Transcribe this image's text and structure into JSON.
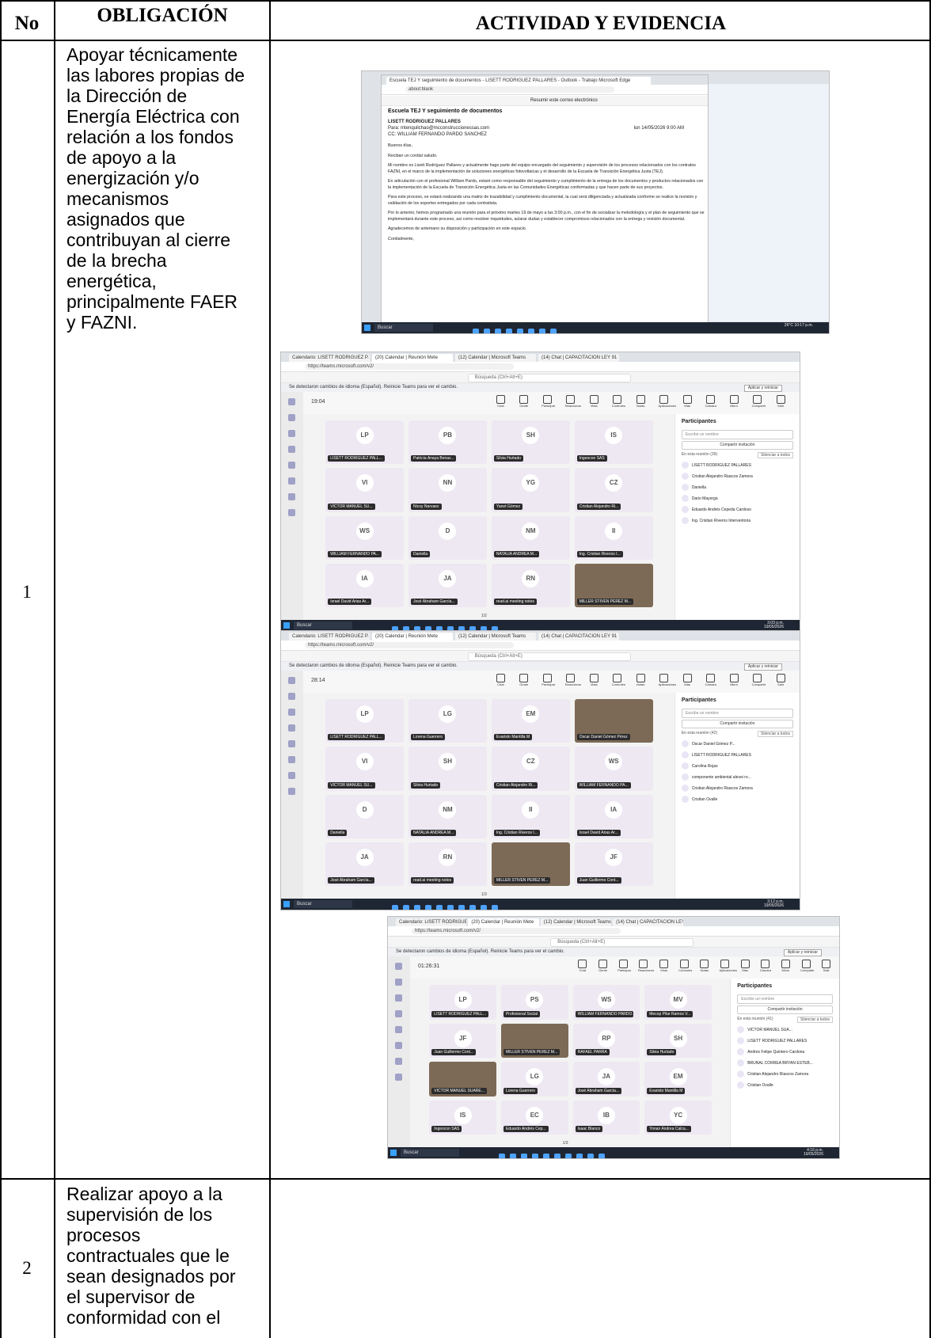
{
  "table": {
    "headers": {
      "no": "No",
      "obligacion": "OBLIGACIÓN",
      "actividad": "ACTIVIDAD Y EVIDENCIA"
    },
    "rows": [
      {
        "no": "1",
        "obligacion_lines": [
          "Apoyar técnicamente",
          "las labores propias de",
          "la Dirección de",
          "Energía Eléctrica con",
          "relación a los fondos",
          "de apoyo a la",
          "energización y/o",
          "mecanismos",
          "asignados que",
          "contribuyan al cierre",
          "de la brecha",
          "energética,",
          "principalmente FAER",
          "y FAZNI."
        ]
      },
      {
        "no": "2",
        "obligacion_lines": [
          "Realizar apoyo a la",
          "supervisión de los",
          "procesos",
          "contractuales que le",
          "sean designados por",
          "el supervisor de",
          "conformidad con el"
        ]
      }
    ]
  },
  "evidence": {
    "email": {
      "window_title": "Escuela TEJ Y seguimiento de documentos - LISETT RODRIGUEZ PALLARES - Outlook - Trabajo Microsoft Edge",
      "url": "about:blank",
      "subject": "Escuela TEJ Y seguimiento de documentos",
      "summarize": "Resumir este correo electrónico",
      "from": "LISETT RODRIGUEZ PALLARES",
      "to": "Para: mtenquilchao@mcconstruccionessas.com",
      "cc": "CC: WILLIAM FERNANDO PARDO SANCHEZ",
      "date": "lun 14/05/2026 9:00 AM",
      "body": [
        "Buenos días,",
        "Reciban un cordial saludo.",
        "Mi nombre es Lisett Rodríguez Pallares y actualmente hago parte del equipo encargado del seguimiento y supervisión de los procesos relacionados con los contratos FAZNI, en el marco de la implementación de soluciones energéticas fotovoltaicas y el desarrollo de la Escuela de Transición Energética Justa (TEJ).",
        "En articulación con el profesional William Pardo, estaré como responsable del seguimiento y cumplimiento de la entrega de los documentos y productos relacionados con la implementación de la Escuela de Transición Energética Justa en las Comunidades Energéticas conformadas y que hacen parte de sus proyectos.",
        "Para este proceso, se estará realizando una matriz de trazabilidad y cumplimiento documental, la cual será diligenciada y actualizada conforme se realice la revisión y validación de los soportes entregados por cada contratista.",
        "Por lo anterior, hemos programado una reunión para el próximo martes 19 de mayo a las 3:00 p.m., con el fin de socializar la metodología y el plan de seguimiento que se implementará durante este proceso, así como resolver inquietudes, aclarar dudas y establecer compromisos relacionados con la entrega y revisión documental.",
        "Agradecemos de antemano su disposición y participación en este espacio.",
        "Cordialmente,"
      ],
      "taskbar_search": "Buscar",
      "temp": "26°C",
      "clock": "10:17 p.m."
    },
    "meetings": [
      {
        "tabs": [
          "Calendario: LISETT RODRIGUEZ P.",
          "(20) Calendar | Reunión Mete",
          "(12) Calendar | Microsoft Teams",
          "(14) Chat | CAPACITACION LEY 91"
        ],
        "url": "https://teams.microsoft.com/v2/",
        "search": "Búsqueda (Ctrl+Alt+E)",
        "notice": "Se detectaron cambios de idioma (Español). Reinicie Teams para ver el cambio.",
        "notice_btn": "Aplicar y reiniciar",
        "timer": "19:04",
        "controls": [
          "Chat",
          "Gente",
          "Participar",
          "Reaccionar",
          "Vista",
          "Controles",
          "Notas",
          "Aplicaciones",
          "Más",
          "Cámara",
          "Micro",
          "Compartir",
          "Salir"
        ],
        "tiles": [
          {
            "i": "LP",
            "n": "LISETT RODRIGUEZ PALL..."
          },
          {
            "i": "PB",
            "n": "Patricia Anaya Benav..."
          },
          {
            "i": "SH",
            "n": "Silvia Hurtado"
          },
          {
            "i": "IS",
            "n": "Ingeocon SAS"
          },
          {
            "i": "VI",
            "n": "VICTOR MANUEL SU..."
          },
          {
            "i": "NN",
            "n": "Nicoy Narvaez"
          },
          {
            "i": "YG",
            "n": "Yanet Gómez"
          },
          {
            "i": "CZ",
            "n": "Cristian Alejandro Ri..."
          },
          {
            "i": "WS",
            "n": "WILLIAM FERNANDO PA..."
          },
          {
            "i": "D",
            "n": "Daniella"
          },
          {
            "i": "NM",
            "n": "NATALIA ANDREA M..."
          },
          {
            "i": "II",
            "n": "Ing. Cristian Riveros I..."
          },
          {
            "i": "IA",
            "n": "Israel David Arias Ar..."
          },
          {
            "i": "JA",
            "n": "José Abraham García..."
          },
          {
            "i": "RN",
            "n": "read.ai meeting notes"
          },
          {
            "i": "",
            "n": "MILLER STIVEN PEREZ M..."
          }
        ],
        "pager": "1/2",
        "panel_title": "Participantes",
        "panel_input": "Escribe un nombre",
        "panel_share": "Compartir invitación",
        "panel_section": "En esta reunión (39)",
        "panel_mute": "Silenciar a todos",
        "participants": [
          {
            "i": "LP",
            "n": "LISETT RODRIGUEZ PALLARES"
          },
          {
            "i": "CZ",
            "n": "Cristian Alejandro Riascos Zamora"
          },
          {
            "i": "D",
            "n": "Daniella"
          },
          {
            "i": "DM",
            "n": "Dario Mayorga"
          },
          {
            "i": "EC",
            "n": "Eduardo Andrés Cepeda Cardoso"
          },
          {
            "i": "II",
            "n": "Ing. Cristian Riveros Interventoria"
          }
        ],
        "organizer": "Organizador",
        "clock": "3:03 p.m.",
        "date": "19/05/2026"
      },
      {
        "tabs": [
          "Calendario: LISETT RODRIGUEZ P.",
          "(20) Calendar | Reunión Mete",
          "(12) Calendar | Microsoft Teams",
          "(14) Chat | CAPACITACION LEY 91"
        ],
        "url": "https://teams.microsoft.com/v2/",
        "search": "Búsqueda (Ctrl+Alt+E)",
        "notice": "Se detectaron cambios de idioma (Español). Reinicie Teams para ver el cambio.",
        "notice_btn": "Aplicar y reiniciar",
        "timer": "28:14",
        "controls": [
          "Chat",
          "Gente",
          "Participar",
          "Reaccionar",
          "Vista",
          "Controles",
          "Notas",
          "Aplicaciones",
          "Más",
          "Cámara",
          "Micro",
          "Compartir",
          "Salir"
        ],
        "tiles": [
          {
            "i": "LP",
            "n": "LISETT RODRIGUEZ PALL..."
          },
          {
            "i": "LG",
            "n": "Lorena Guerrero"
          },
          {
            "i": "EM",
            "n": "Evaristo Mantilla M"
          },
          {
            "i": "",
            "n": "Oscar Daniel Gómez Pérez"
          },
          {
            "i": "VI",
            "n": "VICTOR MANUEL SU..."
          },
          {
            "i": "SH",
            "n": "Silvia Hurtado"
          },
          {
            "i": "CZ",
            "n": "Cristian Alejandro Ri..."
          },
          {
            "i": "WS",
            "n": "WILLIAM FERNANDO PA..."
          },
          {
            "i": "D",
            "n": "Daniella"
          },
          {
            "i": "NM",
            "n": "NATALIA ANDREA M..."
          },
          {
            "i": "II",
            "n": "Ing. Cristian Riveros I..."
          },
          {
            "i": "IA",
            "n": "Israel David Arias Ar..."
          },
          {
            "i": "JA",
            "n": "José Abraham García..."
          },
          {
            "i": "RN",
            "n": "read.ai meeting notes"
          },
          {
            "i": "",
            "n": "MILLER STIVEN PEREZ M..."
          },
          {
            "i": "JF",
            "n": "Juan Guillermo Cont..."
          }
        ],
        "pager": "1/3",
        "panel_title": "Participantes",
        "panel_input": "Escribe un nombre",
        "panel_share": "Compartir invitación",
        "panel_section": "En esta reunión (42)",
        "panel_mute": "Silenciar a todos",
        "participants": [
          {
            "i": "OP",
            "n": "Oscar Daniel Gómez P..."
          },
          {
            "i": "LP",
            "n": "LISETT RODRIGUEZ PALLARES"
          },
          {
            "i": "CR",
            "n": "Carolina Rojas"
          },
          {
            "i": "CR",
            "n": "componente ambiental alexei ro..."
          },
          {
            "i": "CZ",
            "n": "Cristian Alejandro Riascos Zamora"
          },
          {
            "i": "CO",
            "n": "Cristian Ovalle"
          }
        ],
        "organizer": "Organizador",
        "clock": "3:12 p.m.",
        "date": "19/05/2026"
      },
      {
        "tabs": [
          "Calendario: LISETT RODRIGUEZ P.",
          "(20) Calendar | Reunión Mete",
          "(12) Calendar | Microsoft Teams",
          "(14) Chat | CAPACITACION LEY 91"
        ],
        "url": "https://teams.microsoft.com/v2/",
        "search": "Búsqueda (Ctrl+Alt+E)",
        "notice": "Se detectaron cambios de idioma (Español). Reinicie Teams para ver el cambio.",
        "notice_btn": "Aplicar y reiniciar",
        "timer": "01:26:31",
        "controls": [
          "Chat",
          "Gente",
          "Participar",
          "Reaccionar",
          "Vista",
          "Controles",
          "Notas",
          "Aplicaciones",
          "Más",
          "Cámara",
          "Micro",
          "Compartir",
          "Salir"
        ],
        "tiles": [
          {
            "i": "LP",
            "n": "LISETT RODRIGUEZ PALL..."
          },
          {
            "i": "PS",
            "n": "Profesional Social"
          },
          {
            "i": "WS",
            "n": "WILLIAM FERNANDO PARDO..."
          },
          {
            "i": "MV",
            "n": "Mecop Pilar Ramos V..."
          },
          {
            "i": "JF",
            "n": "Juan Guillermo Cont..."
          },
          {
            "i": "",
            "n": "MILLER STIVEN PEREZ M..."
          },
          {
            "i": "RP",
            "n": "RAFAEL PARRA"
          },
          {
            "i": "SH",
            "n": "Silvia Hurtado"
          },
          {
            "i": "",
            "n": "VICTOR MANUEL SUARE..."
          },
          {
            "i": "LG",
            "n": "Lorena Guerrero"
          },
          {
            "i": "JA",
            "n": "José Abraham García..."
          },
          {
            "i": "EM",
            "n": "Evaristo Mantilla M"
          },
          {
            "i": "IS",
            "n": "Ingeocon SAS"
          },
          {
            "i": "EC",
            "n": "Eduardo Andrés Cep..."
          },
          {
            "i": "IB",
            "n": "Isaac Blanco"
          },
          {
            "i": "YC",
            "n": "Yonan Andrea Calca..."
          }
        ],
        "pager": "1/3",
        "panel_title": "Participantes",
        "panel_input": "Escribe un nombre",
        "panel_share": "Compartir invitación",
        "panel_section": "En esta reunión (41)",
        "panel_mute": "Silenciar a todos",
        "participants": [
          {
            "i": "VI",
            "n": "VICTOR MANUEL SUA..."
          },
          {
            "i": "LP",
            "n": "LISETT RODRIGUEZ PALLARES"
          },
          {
            "i": "AC",
            "n": "Andres Felipe Quintero Cardona"
          },
          {
            "i": "BE",
            "n": "BRUNAL CORREA BRYAN ESTEB..."
          },
          {
            "i": "CZ",
            "n": "Cristian Alejandro Riascos Zamora"
          },
          {
            "i": "CO",
            "n": "Cristian Ovalle"
          }
        ],
        "organizer": "Organizador",
        "clock": "4:16 p.m.",
        "date": "19/05/2026"
      }
    ]
  }
}
